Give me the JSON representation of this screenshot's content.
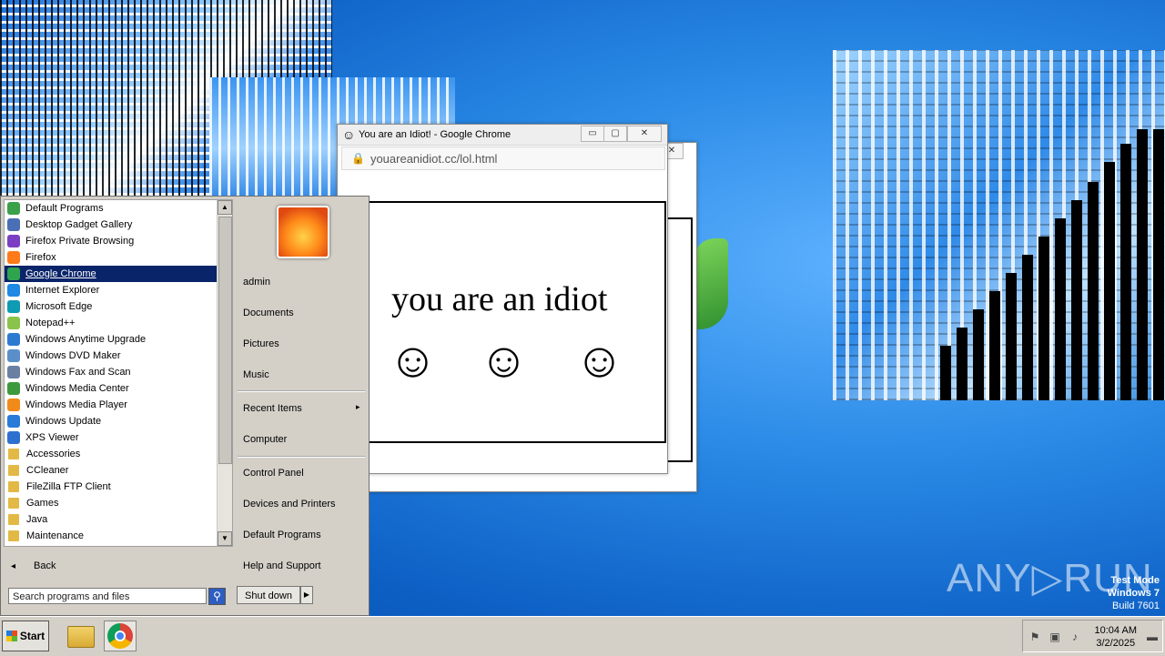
{
  "browser_back": {
    "close_glyph": "✕"
  },
  "browser": {
    "title": "You are an Idiot! - Google Chrome",
    "url": "youareanidiot.cc/lol.html",
    "page_text": "you are an idiot",
    "smiley": "☺",
    "buttons": {
      "minimize": "▭",
      "maximize": "▢",
      "close": "✕"
    }
  },
  "start_menu": {
    "programs": [
      {
        "label": "Default Programs",
        "icon": "default-programs-icon",
        "color": "#3aa04a"
      },
      {
        "label": "Desktop Gadget Gallery",
        "icon": "gadget-icon",
        "color": "#4a6fb5"
      },
      {
        "label": "Firefox Private Browsing",
        "icon": "firefox-private-icon",
        "color": "#7b3fc4"
      },
      {
        "label": "Firefox",
        "icon": "firefox-icon",
        "color": "#ff7a1a"
      },
      {
        "label": "Google Chrome",
        "icon": "chrome-icon",
        "color": "#2ea44f",
        "selected": true
      },
      {
        "label": "Internet Explorer",
        "icon": "ie-icon",
        "color": "#1e88e5"
      },
      {
        "label": "Microsoft Edge",
        "icon": "edge-icon",
        "color": "#0f9bb3"
      },
      {
        "label": "Notepad++",
        "icon": "notepadpp-icon",
        "color": "#8bc34a"
      },
      {
        "label": "Windows Anytime Upgrade",
        "icon": "anytime-upgrade-icon",
        "color": "#2d7bd1"
      },
      {
        "label": "Windows DVD Maker",
        "icon": "dvd-maker-icon",
        "color": "#5a8fc9"
      },
      {
        "label": "Windows Fax and Scan",
        "icon": "fax-scan-icon",
        "color": "#6b7fa3"
      },
      {
        "label": "Windows Media Center",
        "icon": "media-center-icon",
        "color": "#3c9a3c"
      },
      {
        "label": "Windows Media Player",
        "icon": "media-player-icon",
        "color": "#f08a1a"
      },
      {
        "label": "Windows Update",
        "icon": "windows-update-icon",
        "color": "#2a7ad8"
      },
      {
        "label": "XPS Viewer",
        "icon": "xps-viewer-icon",
        "color": "#2f6fd0"
      },
      {
        "label": "Accessories",
        "icon": "folder-icon",
        "folder": true
      },
      {
        "label": "CCleaner",
        "icon": "folder-icon",
        "folder": true
      },
      {
        "label": "FileZilla FTP Client",
        "icon": "folder-icon",
        "folder": true
      },
      {
        "label": "Games",
        "icon": "folder-icon",
        "folder": true
      },
      {
        "label": "Java",
        "icon": "folder-icon",
        "folder": true
      },
      {
        "label": "Maintenance",
        "icon": "folder-icon",
        "folder": true
      }
    ],
    "scroll_up": "▲",
    "scroll_down": "▼",
    "back_arrow": "◂",
    "back_label": "Back",
    "search_placeholder": "Search programs and files",
    "search_glyph": "⚲",
    "right_items": {
      "user": "admin",
      "documents": "Documents",
      "pictures": "Pictures",
      "music": "Music",
      "recent": "Recent Items",
      "computer": "Computer",
      "control_panel": "Control Panel",
      "devices": "Devices and Printers",
      "default_programs": "Default Programs",
      "help": "Help and Support"
    },
    "submenu_arrow": "▸",
    "shutdown": "Shut down",
    "shutdown_arrow": "▶"
  },
  "taskbar": {
    "start": "Start",
    "time": "10:04 AM",
    "date": "3/2/2025",
    "tray_icons": {
      "flag": "⚑",
      "network": "▣",
      "volume": "♪",
      "desktop": "▬"
    }
  },
  "watermark": "ANY▷RUN",
  "test_mode": {
    "line1": "Test Mode",
    "line2": "Windows 7",
    "line3": "Build 7601"
  }
}
